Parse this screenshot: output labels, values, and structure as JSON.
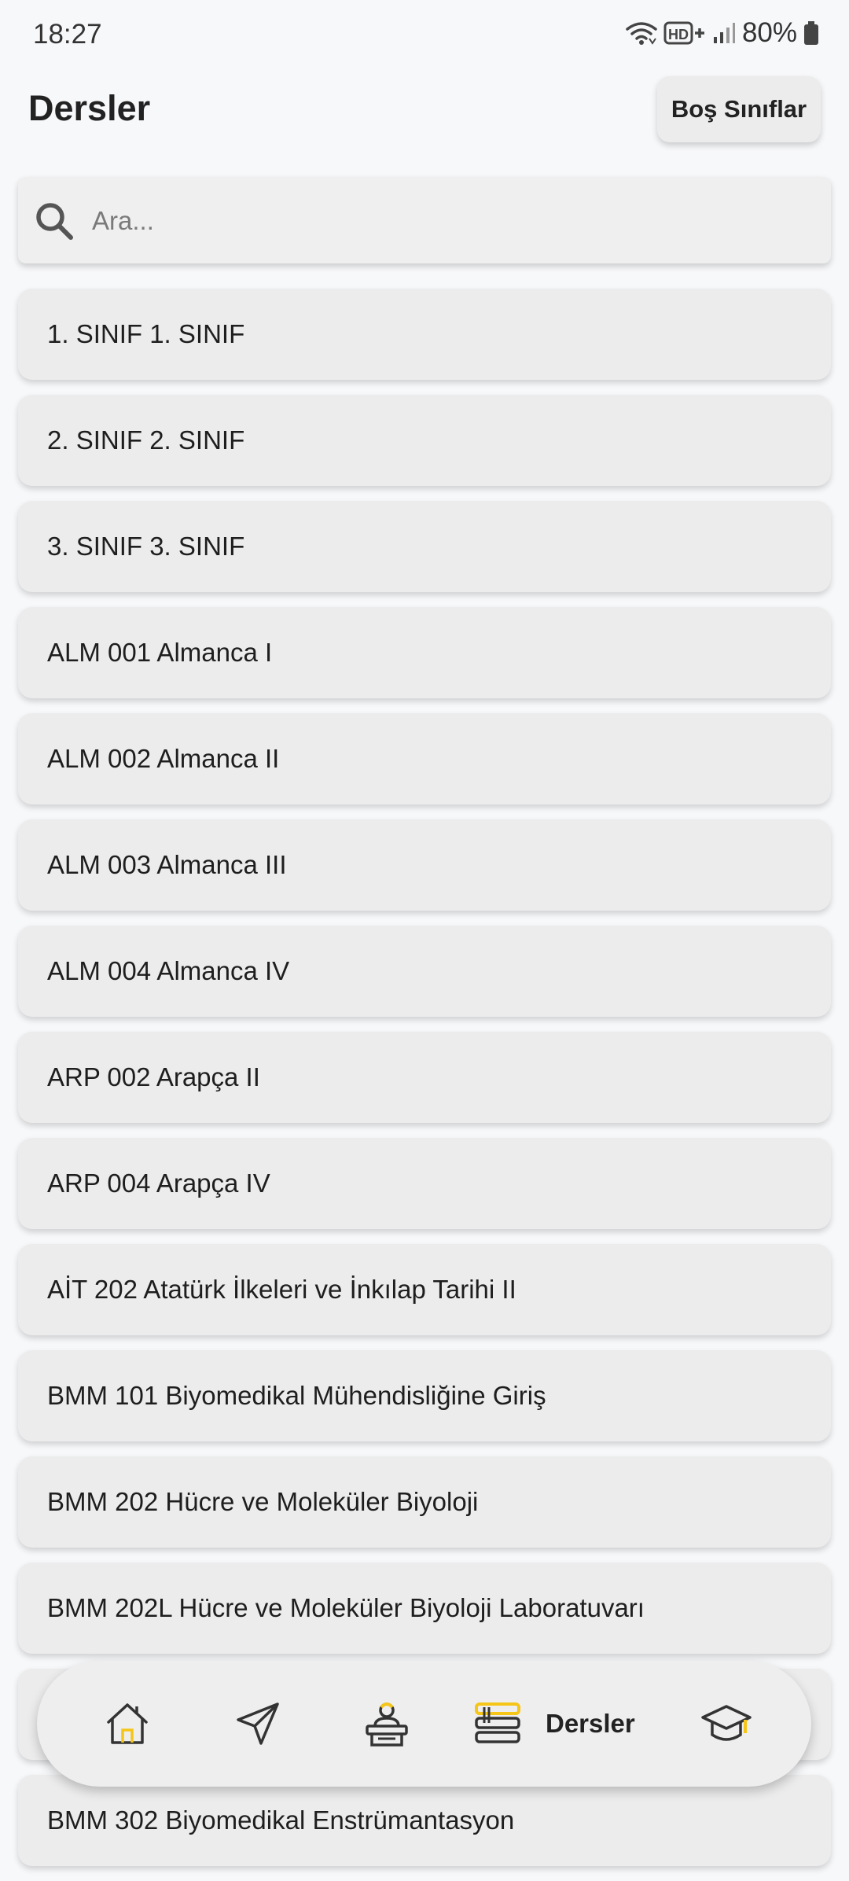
{
  "status_bar": {
    "time": "18:27",
    "battery": "80%"
  },
  "header": {
    "title": "Dersler",
    "empty_rooms_label": "Boş Sınıflar"
  },
  "search": {
    "placeholder": "Ara...",
    "value": ""
  },
  "courses": [
    "1. SINIF 1. SINIF",
    "2. SINIF 2. SINIF",
    "3. SINIF 3. SINIF",
    "ALM 001 Almanca I",
    "ALM 002 Almanca II",
    "ALM 003 Almanca III",
    "ALM 004 Almanca IV",
    "ARP 002 Arapça II",
    "ARP 004 Arapça IV",
    "AİT 202 Atatürk İlkeleri ve İnkılap Tarihi II",
    "BMM 101 Biyomedikal Mühendisliğine Giriş",
    "BMM 202 Hücre ve Moleküler Biyoloji",
    "BMM 202L Hücre ve Moleküler Biyoloji Laboratuvarı",
    "",
    "BMM 302 Biyomedikal Enstrümantasyon"
  ],
  "bottom_nav": {
    "active_label": "Dersler",
    "accent_color": "#f5c518",
    "items": [
      "home-icon",
      "send-icon",
      "teacher-icon",
      "books-icon",
      "graduation-cap-icon"
    ]
  }
}
